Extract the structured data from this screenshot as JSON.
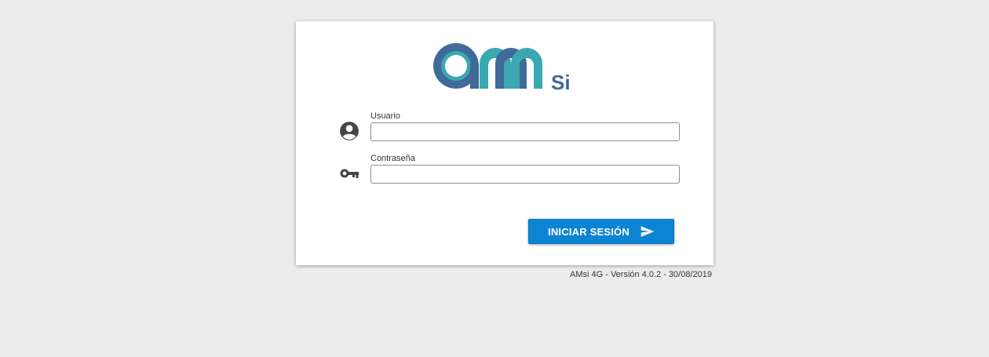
{
  "logo": {
    "text": "AMsi",
    "sub": "Si",
    "colors": {
      "dark_blue": "#3f6a99",
      "teal": "#3aa8b0"
    }
  },
  "form": {
    "username": {
      "label": "Usuario",
      "value": "",
      "placeholder": "",
      "icon": "account-circle-icon"
    },
    "password": {
      "label": "Contraseña",
      "value": "",
      "placeholder": "",
      "icon": "key-icon"
    },
    "submit": {
      "label": "INICIAR SESIÓN",
      "icon": "send-icon",
      "color": "#0b84d3"
    }
  },
  "footer": {
    "version": "AMsi 4G - Versión 4.0.2 - 30/08/2019"
  }
}
